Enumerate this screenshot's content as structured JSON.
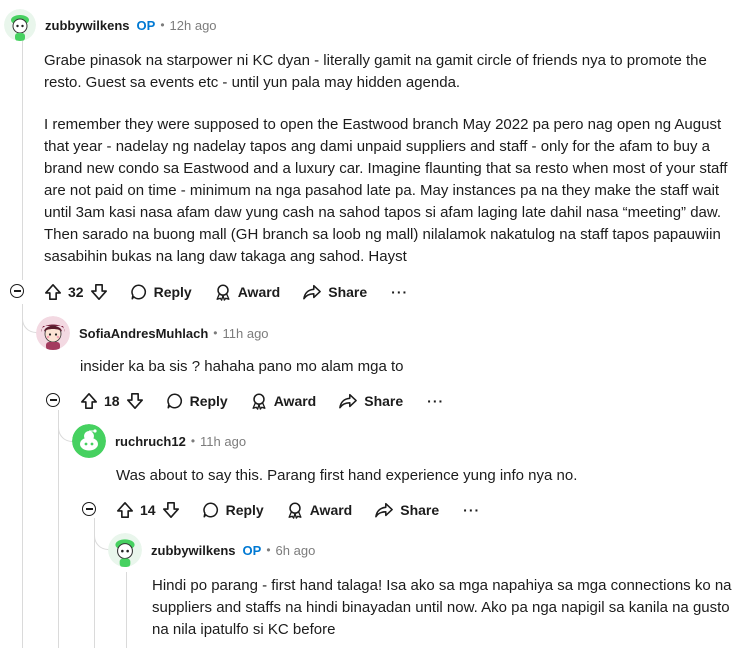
{
  "comments": [
    {
      "author": "zubbywilkens",
      "op_badge": "OP",
      "time": "12h ago",
      "paragraphs": [
        "Grabe pinasok na starpower ni KC dyan - literally gamit na gamit circle of friends nya to promote the resto. Guest sa events etc - until yun pala may hidden agenda.",
        "I remember they were supposed to open the Eastwood branch May 2022 pa pero nag open ng August that year - nadelay ng nadelay tapos ang dami unpaid suppliers and staff - only for the afam to buy a brand new condo sa Eastwood and a luxury car. Imagine flaunting that sa resto when most of your staff are not paid on time - minimum na nga pasahod late pa. May instances pa na they make the staff wait until 3am kasi nasa afam daw yung cash na sahod tapos si afam laging late dahil nasa “meeting” daw. Then sarado na buong mall (GH branch sa loob ng mall) nilalamok nakatulog na staff tapos papauwiin sasabihin bukas na lang daw takaga ang sahod. Hayst"
      ],
      "votes": "32",
      "reply_label": "Reply",
      "award_label": "Award",
      "share_label": "Share",
      "more_label": "···"
    },
    {
      "author": "SofiaAndresMuhlach",
      "time": "11h ago",
      "paragraphs": [
        "insider ka ba sis ? hahaha pano mo alam mga to"
      ],
      "votes": "18",
      "reply_label": "Reply",
      "award_label": "Award",
      "share_label": "Share",
      "more_label": "···"
    },
    {
      "author": "ruchruch12",
      "time": "11h ago",
      "paragraphs": [
        "Was about to say this. Parang first hand experience yung info nya no."
      ],
      "votes": "14",
      "reply_label": "Reply",
      "award_label": "Award",
      "share_label": "Share",
      "more_label": "···"
    },
    {
      "author": "zubbywilkens",
      "op_badge": "OP",
      "time": "6h ago",
      "paragraphs": [
        "Hindi po parang - first hand talaga! Isa ako sa mga napahiya sa mga connections ko na suppliers and staffs na hindi binayadan until now. Ako pa nga napigil sa kanila na gusto na nila ipatulfo si KC before"
      ]
    }
  ],
  "colors": {
    "op_blue": "#0079d3",
    "thread_line": "#dadada",
    "muted": "#7c7c7c",
    "snoo_green": "#46d160"
  }
}
